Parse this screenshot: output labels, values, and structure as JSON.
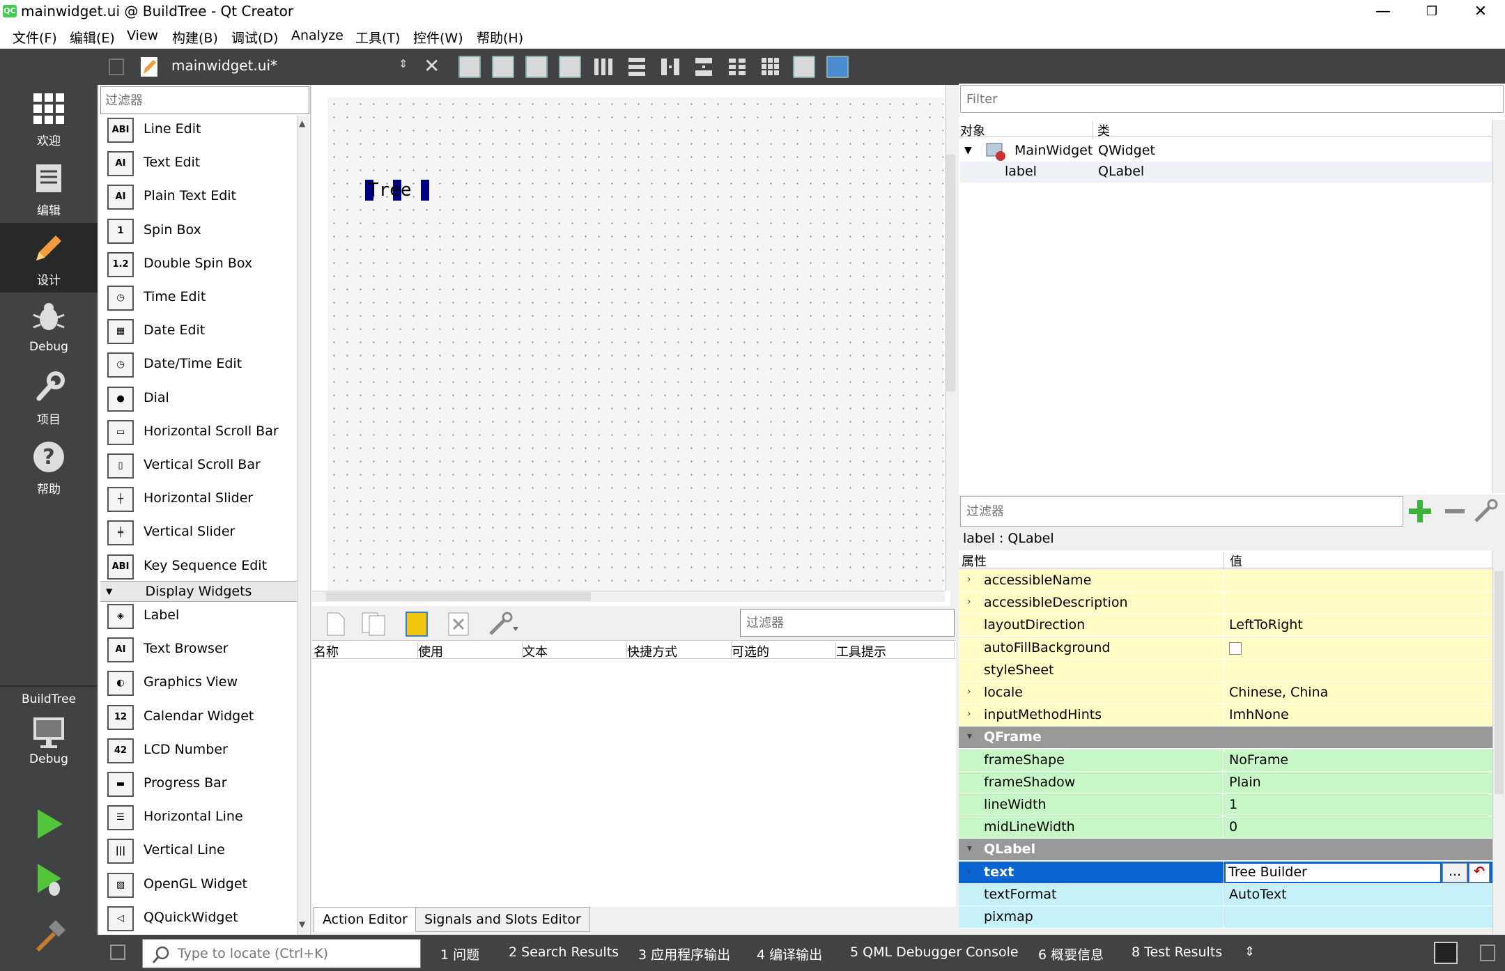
{
  "window": {
    "title": "mainwidget.ui @ BuildTree - Qt Creator",
    "logo": "QC"
  },
  "menu": [
    "文件(F)",
    "编辑(E)",
    "View",
    "构建(B)",
    "调试(D)",
    "Analyze",
    "工具(T)",
    "控件(W)",
    "帮助(H)"
  ],
  "modes": [
    {
      "icon": "grid-icon",
      "label": "欢迎"
    },
    {
      "icon": "document-icon",
      "label": "编辑"
    },
    {
      "icon": "pencil-icon",
      "label": "设计"
    },
    {
      "icon": "bug-icon",
      "label": "Debug"
    },
    {
      "icon": "wrench-icon",
      "label": "项目"
    },
    {
      "icon": "help-icon",
      "label": "帮助"
    }
  ],
  "kit": {
    "project": "BuildTree",
    "mode": "Debug"
  },
  "editor": {
    "file": "mainwidget.ui*"
  },
  "widgetbox": {
    "filter_placeholder": "过滤器",
    "input_items": [
      {
        "icon": "line-edit-icon",
        "glyph": "ABI",
        "label": "Line Edit"
      },
      {
        "icon": "text-edit-icon",
        "glyph": "AI",
        "label": "Text Edit"
      },
      {
        "icon": "plain-text-edit-icon",
        "glyph": "AI",
        "label": "Plain Text Edit"
      },
      {
        "icon": "spin-box-icon",
        "glyph": "1",
        "label": "Spin Box"
      },
      {
        "icon": "double-spin-box-icon",
        "glyph": "1.2",
        "label": "Double Spin Box"
      },
      {
        "icon": "time-edit-icon",
        "glyph": "◷",
        "label": "Time Edit"
      },
      {
        "icon": "date-edit-icon",
        "glyph": "▦",
        "label": "Date Edit"
      },
      {
        "icon": "datetime-edit-icon",
        "glyph": "◷",
        "label": "Date/Time Edit"
      },
      {
        "icon": "dial-icon",
        "glyph": "●",
        "label": "Dial"
      },
      {
        "icon": "horizontal-scroll-bar-icon",
        "glyph": "▭",
        "label": "Horizontal Scroll Bar"
      },
      {
        "icon": "vertical-scroll-bar-icon",
        "glyph": "▯",
        "label": "Vertical Scroll Bar"
      },
      {
        "icon": "horizontal-slider-icon",
        "glyph": "┼",
        "label": "Horizontal Slider"
      },
      {
        "icon": "vertical-slider-icon",
        "glyph": "╪",
        "label": "Vertical Slider"
      },
      {
        "icon": "key-sequence-edit-icon",
        "glyph": "ABI",
        "label": "Key Sequence Edit"
      }
    ],
    "category": "Display Widgets",
    "display_items": [
      {
        "icon": "label-icon",
        "glyph": "◈",
        "label": "Label"
      },
      {
        "icon": "text-browser-icon",
        "glyph": "AI",
        "label": "Text Browser"
      },
      {
        "icon": "graphics-view-icon",
        "glyph": "◐",
        "label": "Graphics View"
      },
      {
        "icon": "calendar-widget-icon",
        "glyph": "12",
        "label": "Calendar Widget"
      },
      {
        "icon": "lcd-number-icon",
        "glyph": "42",
        "label": "LCD Number"
      },
      {
        "icon": "progress-bar-icon",
        "glyph": "▬",
        "label": "Progress Bar"
      },
      {
        "icon": "horizontal-line-icon",
        "glyph": "☰",
        "label": "Horizontal Line"
      },
      {
        "icon": "vertical-line-icon",
        "glyph": "|||",
        "label": "Vertical Line"
      },
      {
        "icon": "opengl-widget-icon",
        "glyph": "▨",
        "label": "OpenGL Widget"
      },
      {
        "icon": "qquickwidget-icon",
        "glyph": "◁",
        "label": "QQuickWidget"
      }
    ]
  },
  "canvas": {
    "label_text": "Tree"
  },
  "action_editor": {
    "filter_placeholder": "过滤器",
    "columns": [
      "名称",
      "使用",
      "文本",
      "快捷方式",
      "可选的",
      "工具提示"
    ]
  },
  "bottom_tabs": [
    "Action Editor",
    "Signals and Slots Editor"
  ],
  "object_inspector": {
    "filter_placeholder": "Filter",
    "col_object": "对象",
    "col_class": "类",
    "rows": [
      {
        "object": "MainWidget",
        "class": "QWidget"
      },
      {
        "object": "label",
        "class": "QLabel"
      }
    ]
  },
  "property_editor": {
    "filter_placeholder": "过滤器",
    "title": "label : QLabel",
    "col_prop": "属性",
    "col_value": "值",
    "rows": [
      {
        "name": "accessibleName",
        "value": "",
        "arrow": "›",
        "cls": "y"
      },
      {
        "name": "accessibleDescription",
        "value": "",
        "arrow": "›",
        "cls": "y"
      },
      {
        "name": "layoutDirection",
        "value": "LeftToRight",
        "arrow": "",
        "cls": "y"
      },
      {
        "name": "autoFillBackground",
        "value": "",
        "arrow": "",
        "cls": "y",
        "checkbox": true
      },
      {
        "name": "styleSheet",
        "value": "",
        "arrow": "",
        "cls": "y"
      },
      {
        "name": "locale",
        "value": "Chinese, China",
        "arrow": "›",
        "cls": "y"
      },
      {
        "name": "inputMethodHints",
        "value": "ImhNone",
        "arrow": "›",
        "cls": "y"
      },
      {
        "name": "QFrame",
        "value": "",
        "arrow": "▾",
        "cls": "grp"
      },
      {
        "name": "frameShape",
        "value": "NoFrame",
        "arrow": "",
        "cls": "g"
      },
      {
        "name": "frameShadow",
        "value": "Plain",
        "arrow": "",
        "cls": "g"
      },
      {
        "name": "lineWidth",
        "value": "1",
        "arrow": "",
        "cls": "g"
      },
      {
        "name": "midLineWidth",
        "value": "0",
        "arrow": "",
        "cls": "g"
      },
      {
        "name": "QLabel",
        "value": "",
        "arrow": "▾",
        "cls": "grp"
      },
      {
        "name": "text",
        "value": "Tree Builder",
        "arrow": "›",
        "cls": "sel",
        "editing": true
      },
      {
        "name": "textFormat",
        "value": "AutoText",
        "arrow": "",
        "cls": "b"
      },
      {
        "name": "pixmap",
        "value": "",
        "arrow": "",
        "cls": "b"
      }
    ],
    "more_button": "...",
    "reset_icon": "↶"
  },
  "statusbar": {
    "locate_placeholder": "Type to locate (Ctrl+K)",
    "panes": [
      "1 问题",
      "2 Search Results",
      "3 应用程序输出",
      "4 编译输出",
      "5 QML Debugger Console",
      "6 概要信息",
      "8 Test Results"
    ]
  }
}
